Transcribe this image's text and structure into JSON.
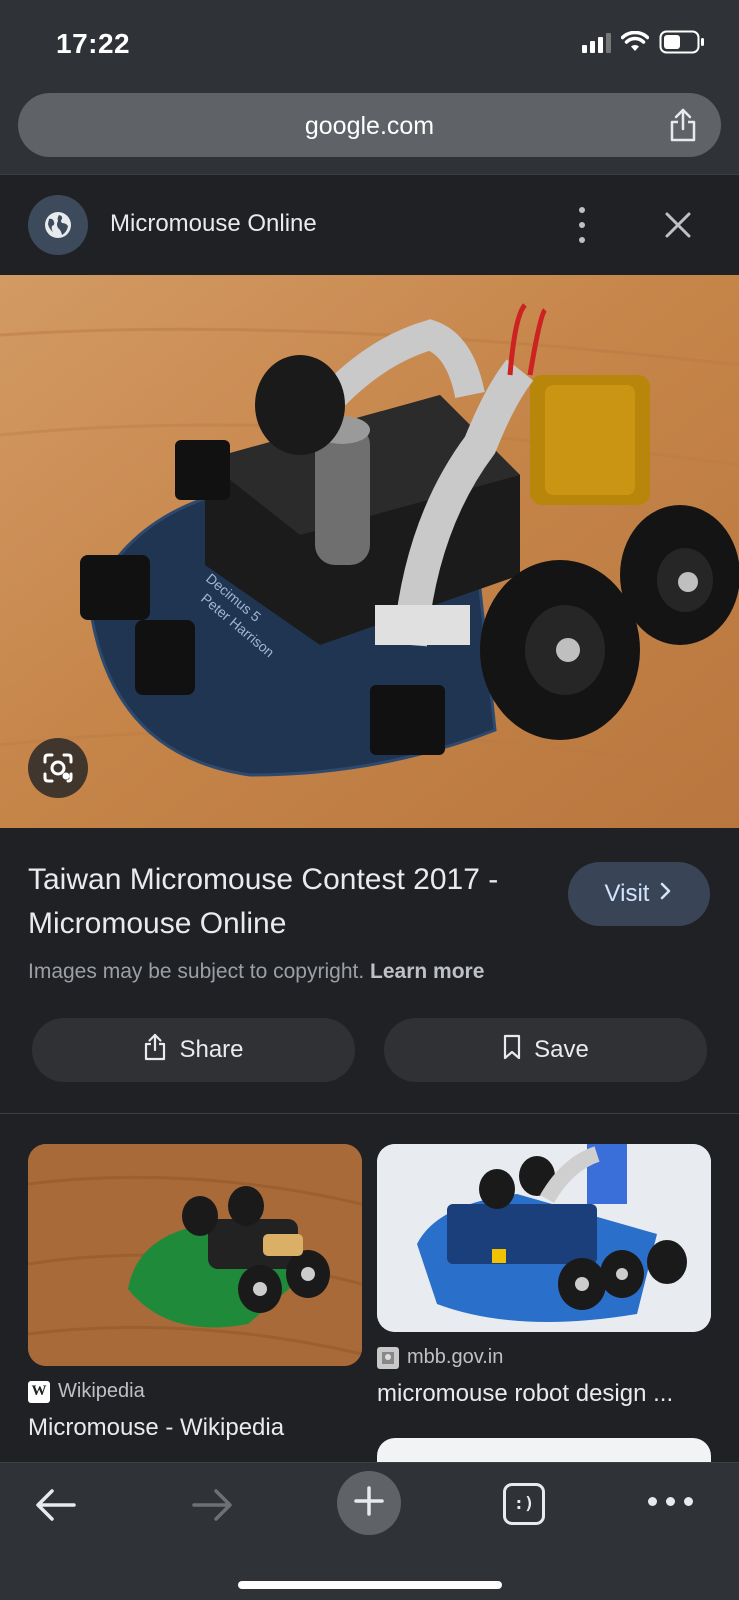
{
  "status_bar": {
    "time": "17:22"
  },
  "address_bar": {
    "url": "google.com"
  },
  "panel": {
    "site_name": "Micromouse Online"
  },
  "result": {
    "title": "Taiwan Micromouse Contest 2017 - Micromouse Online",
    "visit_label": "Visit",
    "copyright_text": "Images may be subject to copyright.",
    "learn_more": "Learn more",
    "share_label": "Share",
    "save_label": "Save"
  },
  "related": [
    {
      "source": "Wikipedia",
      "title": "Micromouse - Wikipedia",
      "favicon": "W"
    },
    {
      "source": "mbb.gov.in",
      "title": "micromouse robot design ..."
    }
  ],
  "icons": {
    "globe": "globe-icon",
    "share": "share-icon",
    "lens": "lens-icon",
    "bookmark": "bookmark-icon",
    "close": "close-icon",
    "more": "more-vert-icon"
  },
  "colors": {
    "background": "#202124",
    "chrome": "#2f3236",
    "visit_button": "#394457",
    "action_button": "#303134"
  }
}
